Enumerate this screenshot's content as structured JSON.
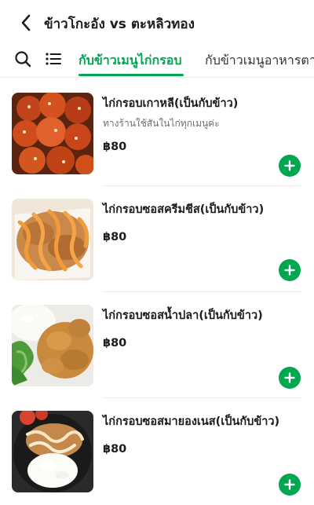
{
  "header": {
    "back_icon": "chevron-left-icon",
    "title": "ข้าวโกะอัง vs ตะหลิวทอง"
  },
  "tabs": {
    "search_icon": "search-icon",
    "list_icon": "menu-list-icon",
    "items": [
      {
        "label": "กับข้าวเมนูไก่กรอบ",
        "active": true
      },
      {
        "label": "กับข้าวเมนูอาหารตาม",
        "active": false
      }
    ]
  },
  "colors": {
    "accent": "#00a650",
    "text": "#1c1c1c",
    "muted": "#6e6e6e"
  },
  "menu": {
    "items": [
      {
        "name": "ไก่กรอบเกาหลี(เป็นกับข้าว)",
        "description": "ทางร้านใช้สันในไก่ทุกเมนูค่ะ",
        "price": "฿80",
        "add_icon": "plus-icon"
      },
      {
        "name": "ไก่กรอบซอสครีมชีส(เป็นกับข้าว)",
        "description": "",
        "price": "฿80",
        "add_icon": "plus-icon"
      },
      {
        "name": "ไก่กรอบซอสน้ำปลา(เป็นกับข้าว)",
        "description": "",
        "price": "฿80",
        "add_icon": "plus-icon"
      },
      {
        "name": "ไก่กรอบซอสมายองเนส(เป็นกับข้าว)",
        "description": "",
        "price": "฿80",
        "add_icon": "plus-icon"
      }
    ]
  }
}
